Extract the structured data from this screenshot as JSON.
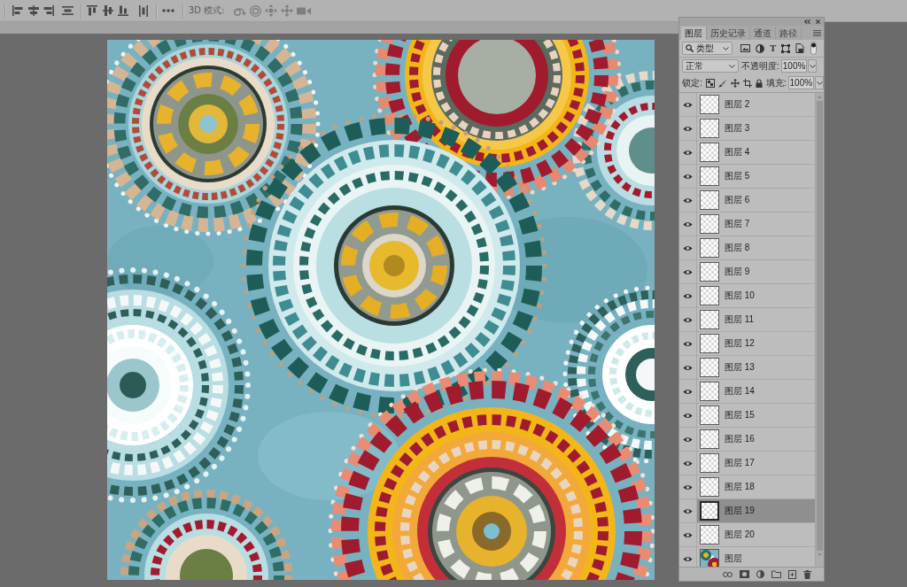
{
  "options_bar": {
    "mode": {
      "label": "3D 模式:",
      "disabled": true
    }
  },
  "layers_panel": {
    "tabs": [
      {
        "label": "图层",
        "selected": true
      },
      {
        "label": "历史记录",
        "selected": false
      },
      {
        "label": "通道",
        "selected": false
      },
      {
        "label": "路径",
        "selected": false
      }
    ],
    "filter": {
      "value": "类型",
      "text_filter": "T",
      "enabled": true
    },
    "blend_mode": "正常",
    "opacity": {
      "label": "不透明度:",
      "value": "100%"
    },
    "lock_label": "锁定:",
    "fill": {
      "label": "填充:",
      "value": "100%"
    },
    "layers": [
      {
        "name": "图层 2",
        "visible": true,
        "selected": false,
        "kind": "transparent"
      },
      {
        "name": "图层 3",
        "visible": true,
        "selected": false,
        "kind": "transparent"
      },
      {
        "name": "图层 4",
        "visible": true,
        "selected": false,
        "kind": "transparent"
      },
      {
        "name": "图层 5",
        "visible": true,
        "selected": false,
        "kind": "transparent"
      },
      {
        "name": "图层 6",
        "visible": true,
        "selected": false,
        "kind": "transparent"
      },
      {
        "name": "图层 7",
        "visible": true,
        "selected": false,
        "kind": "transparent"
      },
      {
        "name": "图层 8",
        "visible": true,
        "selected": false,
        "kind": "transparent"
      },
      {
        "name": "图层 9",
        "visible": true,
        "selected": false,
        "kind": "transparent"
      },
      {
        "name": "图层 10",
        "visible": true,
        "selected": false,
        "kind": "transparent"
      },
      {
        "name": "图层 11",
        "visible": true,
        "selected": false,
        "kind": "transparent"
      },
      {
        "name": "图层 12",
        "visible": true,
        "selected": false,
        "kind": "transparent"
      },
      {
        "name": "图层 13",
        "visible": true,
        "selected": false,
        "kind": "transparent"
      },
      {
        "name": "图层 14",
        "visible": true,
        "selected": false,
        "kind": "transparent"
      },
      {
        "name": "图层 15",
        "visible": true,
        "selected": false,
        "kind": "transparent"
      },
      {
        "name": "图层 16",
        "visible": true,
        "selected": false,
        "kind": "transparent"
      },
      {
        "name": "图层 17",
        "visible": true,
        "selected": false,
        "kind": "transparent"
      },
      {
        "name": "图层 18",
        "visible": true,
        "selected": false,
        "kind": "transparent"
      },
      {
        "name": "图层 19",
        "visible": true,
        "selected": true,
        "kind": "transparent"
      },
      {
        "name": "图层 20",
        "visible": true,
        "selected": false,
        "kind": "transparent"
      },
      {
        "name": "图层",
        "visible": true,
        "selected": false,
        "kind": "pattern"
      }
    ]
  }
}
